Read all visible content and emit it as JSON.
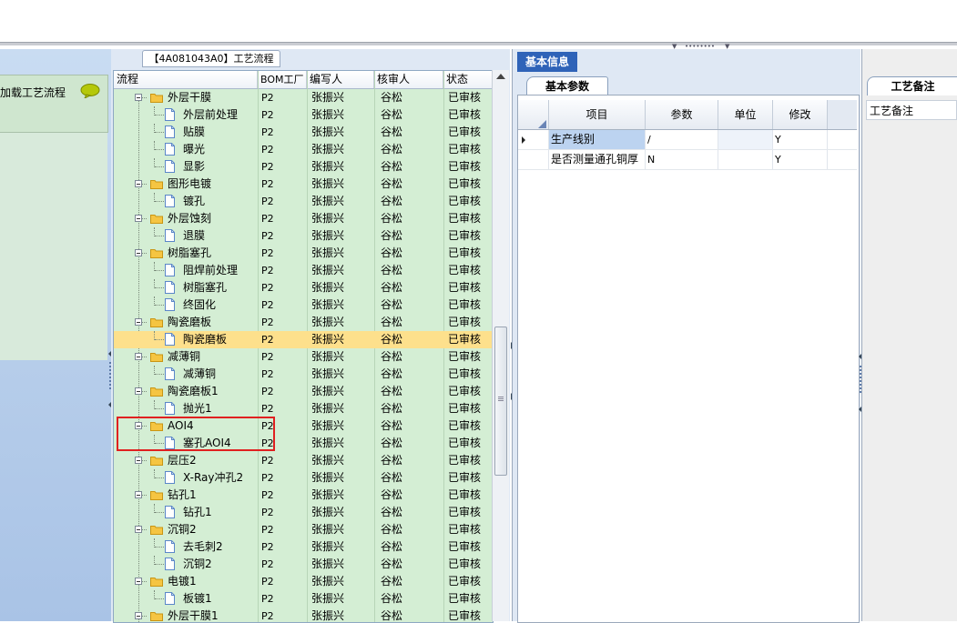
{
  "colors": {
    "accent": "#2f63b8",
    "tree_bg": "#d4eed4",
    "selected_row": "#fde08c",
    "highlight_box": "#e02020"
  },
  "left": {
    "load_flow_label": "加载工艺流程",
    "chat_icon": "speech-bubble-icon"
  },
  "center": {
    "title": "【4A081043A0】工艺流程",
    "columns": [
      "流程",
      "BOM工厂",
      "编写人",
      "核审人",
      "状态"
    ],
    "rows": [
      {
        "level": 1,
        "type": "folder",
        "name": "外层干膜",
        "bom": "P2",
        "writer": "张振兴",
        "reviewer": "谷松",
        "status": "已审核"
      },
      {
        "level": 2,
        "type": "file",
        "name": "外层前处理",
        "bom": "P2",
        "writer": "张振兴",
        "reviewer": "谷松",
        "status": "已审核"
      },
      {
        "level": 2,
        "type": "file",
        "name": "贴膜",
        "bom": "P2",
        "writer": "张振兴",
        "reviewer": "谷松",
        "status": "已审核"
      },
      {
        "level": 2,
        "type": "file",
        "name": "曝光",
        "bom": "P2",
        "writer": "张振兴",
        "reviewer": "谷松",
        "status": "已审核"
      },
      {
        "level": 2,
        "type": "file",
        "name": "显影",
        "bom": "P2",
        "writer": "张振兴",
        "reviewer": "谷松",
        "status": "已审核"
      },
      {
        "level": 1,
        "type": "folder",
        "name": "图形电镀",
        "bom": "P2",
        "writer": "张振兴",
        "reviewer": "谷松",
        "status": "已审核"
      },
      {
        "level": 2,
        "type": "file",
        "name": "镀孔",
        "bom": "P2",
        "writer": "张振兴",
        "reviewer": "谷松",
        "status": "已审核"
      },
      {
        "level": 1,
        "type": "folder",
        "name": "外层蚀刻",
        "bom": "P2",
        "writer": "张振兴",
        "reviewer": "谷松",
        "status": "已审核"
      },
      {
        "level": 2,
        "type": "file",
        "name": "退膜",
        "bom": "P2",
        "writer": "张振兴",
        "reviewer": "谷松",
        "status": "已审核"
      },
      {
        "level": 1,
        "type": "folder",
        "name": "树脂塞孔",
        "bom": "P2",
        "writer": "张振兴",
        "reviewer": "谷松",
        "status": "已审核"
      },
      {
        "level": 2,
        "type": "file",
        "name": "阻焊前处理",
        "bom": "P2",
        "writer": "张振兴",
        "reviewer": "谷松",
        "status": "已审核"
      },
      {
        "level": 2,
        "type": "file",
        "name": "树脂塞孔",
        "bom": "P2",
        "writer": "张振兴",
        "reviewer": "谷松",
        "status": "已审核"
      },
      {
        "level": 2,
        "type": "file",
        "name": "终固化",
        "bom": "P2",
        "writer": "张振兴",
        "reviewer": "谷松",
        "status": "已审核"
      },
      {
        "level": 1,
        "type": "folder",
        "name": "陶瓷磨板",
        "bom": "P2",
        "writer": "张振兴",
        "reviewer": "谷松",
        "status": "已审核"
      },
      {
        "level": 2,
        "type": "file",
        "name": "陶瓷磨板",
        "bom": "P2",
        "writer": "张振兴",
        "reviewer": "谷松",
        "status": "已审核",
        "selected": true
      },
      {
        "level": 1,
        "type": "folder",
        "name": "减薄铜",
        "bom": "P2",
        "writer": "张振兴",
        "reviewer": "谷松",
        "status": "已审核"
      },
      {
        "level": 2,
        "type": "file",
        "name": "减薄铜",
        "bom": "P2",
        "writer": "张振兴",
        "reviewer": "谷松",
        "status": "已审核"
      },
      {
        "level": 1,
        "type": "folder",
        "name": "陶瓷磨板1",
        "bom": "P2",
        "writer": "张振兴",
        "reviewer": "谷松",
        "status": "已审核"
      },
      {
        "level": 2,
        "type": "file",
        "name": "抛光1",
        "bom": "P2",
        "writer": "张振兴",
        "reviewer": "谷松",
        "status": "已审核"
      },
      {
        "level": 1,
        "type": "folder",
        "name": "AOI4",
        "bom": "P2",
        "writer": "张振兴",
        "reviewer": "谷松",
        "status": "已审核"
      },
      {
        "level": 2,
        "type": "file",
        "name": "塞孔AOI4",
        "bom": "P2",
        "writer": "张振兴",
        "reviewer": "谷松",
        "status": "已审核"
      },
      {
        "level": 1,
        "type": "folder",
        "name": "层压2",
        "bom": "P2",
        "writer": "张振兴",
        "reviewer": "谷松",
        "status": "已审核"
      },
      {
        "level": 2,
        "type": "file",
        "name": "X-Ray冲孔2",
        "bom": "P2",
        "writer": "张振兴",
        "reviewer": "谷松",
        "status": "已审核"
      },
      {
        "level": 1,
        "type": "folder",
        "name": "钻孔1",
        "bom": "P2",
        "writer": "张振兴",
        "reviewer": "谷松",
        "status": "已审核"
      },
      {
        "level": 2,
        "type": "file",
        "name": "钻孔1",
        "bom": "P2",
        "writer": "张振兴",
        "reviewer": "谷松",
        "status": "已审核"
      },
      {
        "level": 1,
        "type": "folder",
        "name": "沉铜2",
        "bom": "P2",
        "writer": "张振兴",
        "reviewer": "谷松",
        "status": "已审核"
      },
      {
        "level": 2,
        "type": "file",
        "name": "去毛刺2",
        "bom": "P2",
        "writer": "张振兴",
        "reviewer": "谷松",
        "status": "已审核"
      },
      {
        "level": 2,
        "type": "file",
        "name": "沉铜2",
        "bom": "P2",
        "writer": "张振兴",
        "reviewer": "谷松",
        "status": "已审核"
      },
      {
        "level": 1,
        "type": "folder",
        "name": "电镀1",
        "bom": "P2",
        "writer": "张振兴",
        "reviewer": "谷松",
        "status": "已审核"
      },
      {
        "level": 2,
        "type": "file",
        "name": "板镀1",
        "bom": "P2",
        "writer": "张振兴",
        "reviewer": "谷松",
        "status": "已审核"
      },
      {
        "level": 1,
        "type": "folder",
        "name": "外层干膜1",
        "bom": "P2",
        "writer": "张振兴",
        "reviewer": "谷松",
        "status": "已审核"
      }
    ]
  },
  "info": {
    "tab_label": "基本信息",
    "subtab_label": "基本参数",
    "columns": [
      "项目",
      "参数",
      "单位",
      "修改"
    ],
    "rows": [
      {
        "item": "生产线别",
        "param": "/",
        "unit": "",
        "modify": "Y",
        "current": true
      },
      {
        "item": "是否测量通孔铜厚",
        "param": "N",
        "unit": "",
        "modify": "Y",
        "current": false
      }
    ]
  },
  "remark": {
    "tab_label": "工艺备注",
    "label": "工艺备注"
  }
}
